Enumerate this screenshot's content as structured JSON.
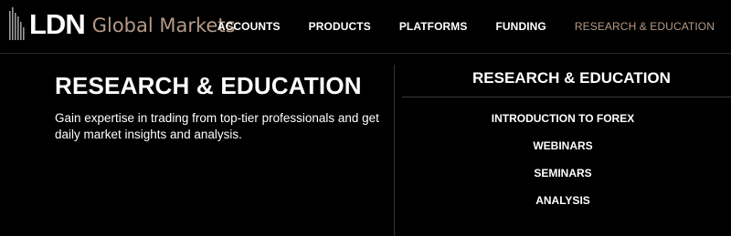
{
  "brand": {
    "logo_ldn": "LDN",
    "logo_global_markets": "Global Markets",
    "accent_color": "#b59a86"
  },
  "nav": {
    "items": [
      {
        "label": "ACCOUNTS"
      },
      {
        "label": "PRODUCTS"
      },
      {
        "label": "PLATFORMS"
      },
      {
        "label": "FUNDING"
      },
      {
        "label": "RESEARCH & EDUCATION",
        "active": true
      }
    ]
  },
  "panel": {
    "title": "RESEARCH & EDUCATION",
    "description": "Gain expertise in trading from top-tier professionals and get daily market insights and analysis.",
    "section_title": "RESEARCH & EDUCATION",
    "links": [
      {
        "label": "INTRODUCTION TO FOREX"
      },
      {
        "label": "WEBINARS"
      },
      {
        "label": "SEMINARS"
      },
      {
        "label": "ANALYSIS"
      }
    ]
  }
}
